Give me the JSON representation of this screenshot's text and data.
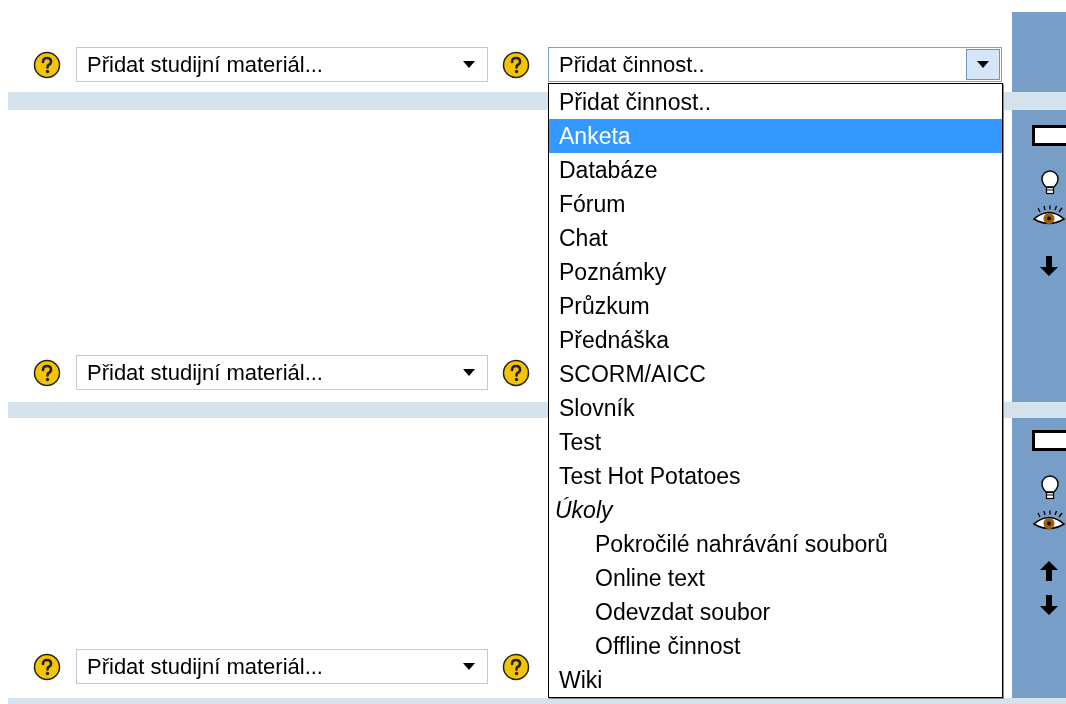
{
  "sections": [
    {
      "resource_select": {
        "value": "Přidat studijní materiál..."
      },
      "activity_select": {
        "value": "Přidat činnost.."
      }
    },
    {
      "resource_select": {
        "value": "Přidat studijní materiál..."
      },
      "tools": [
        {
          "kind": "box"
        },
        {
          "kind": "bulb"
        },
        {
          "kind": "eye"
        },
        {
          "kind": "down"
        }
      ]
    },
    {
      "resource_select": {
        "value": "Přidat studijní materiál..."
      },
      "tools": [
        {
          "kind": "box"
        },
        {
          "kind": "bulb"
        },
        {
          "kind": "eye"
        },
        {
          "kind": "up"
        },
        {
          "kind": "down"
        }
      ]
    }
  ],
  "activity_list": {
    "options": [
      {
        "kind": "option",
        "label": "Přidat činnost..",
        "selected": false
      },
      {
        "kind": "option",
        "label": "Anketa",
        "selected": true
      },
      {
        "kind": "option",
        "label": "Databáze",
        "selected": false
      },
      {
        "kind": "option",
        "label": "Fórum",
        "selected": false
      },
      {
        "kind": "option",
        "label": "Chat",
        "selected": false
      },
      {
        "kind": "option",
        "label": "Poznámky",
        "selected": false
      },
      {
        "kind": "option",
        "label": "Průzkum",
        "selected": false
      },
      {
        "kind": "option",
        "label": "Přednáška",
        "selected": false
      },
      {
        "kind": "option",
        "label": "SCORM/AICC",
        "selected": false
      },
      {
        "kind": "option",
        "label": "Slovník",
        "selected": false
      },
      {
        "kind": "option",
        "label": "Test",
        "selected": false
      },
      {
        "kind": "option",
        "label": "Test Hot Potatoes",
        "selected": false
      },
      {
        "kind": "group",
        "label": "Úkoly",
        "children": [
          {
            "kind": "option",
            "label": "Pokročilé nahrávání souborů",
            "selected": false
          },
          {
            "kind": "option",
            "label": "Online text",
            "selected": false
          },
          {
            "kind": "option",
            "label": "Odevzdat soubor",
            "selected": false
          },
          {
            "kind": "option",
            "label": "Offline činnost",
            "selected": false
          }
        ]
      },
      {
        "kind": "option",
        "label": "Wiki",
        "selected": false
      }
    ]
  }
}
